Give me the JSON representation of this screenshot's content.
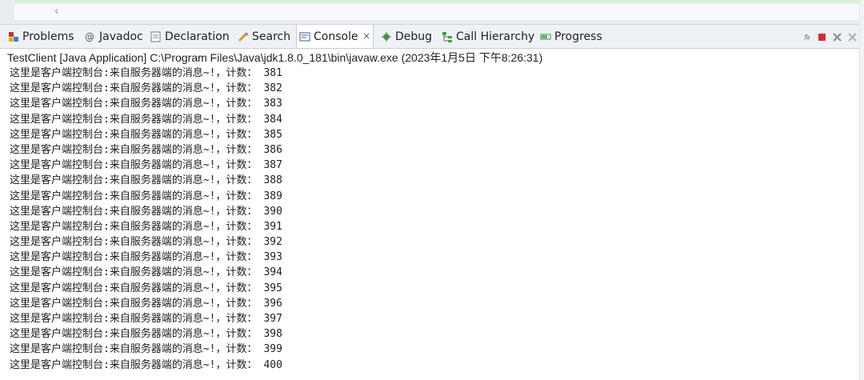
{
  "editor": {
    "scroll_left_glyph": "‹"
  },
  "tabs": [
    {
      "label": "Problems",
      "icon": "problems-icon"
    },
    {
      "label": "Javadoc",
      "icon": "javadoc-icon"
    },
    {
      "label": "Declaration",
      "icon": "declaration-icon"
    },
    {
      "label": "Search",
      "icon": "search-icon"
    },
    {
      "label": "Console",
      "icon": "console-icon",
      "active": true,
      "close": "✕"
    },
    {
      "label": "Debug",
      "icon": "debug-icon"
    },
    {
      "label": "Call Hierarchy",
      "icon": "call-hierarchy-icon"
    },
    {
      "label": "Progress",
      "icon": "progress-icon"
    }
  ],
  "view_tools": [
    "pin-icon",
    "terminate-icon",
    "remove-launch-icon",
    "remove-all-icon"
  ],
  "console": {
    "title": "TestClient [Java Application] C:\\Program Files\\Java\\jdk1.8.0_181\\bin\\javaw.exe (2023年1月5日 下午8:26:31)",
    "message_prefix": "这里是客户端控制台:来自服务器端的消息~!，计数：",
    "lines": [
      "381",
      "382",
      "383",
      "384",
      "385",
      "386",
      "387",
      "388",
      "389",
      "390",
      "391",
      "392",
      "393",
      "394",
      "395",
      "396",
      "397",
      "398",
      "399",
      "400"
    ]
  },
  "colors": {
    "accent_red": "#d32f2f",
    "tab_bar_bg": "#eef1f5",
    "console_text": "#202020"
  }
}
